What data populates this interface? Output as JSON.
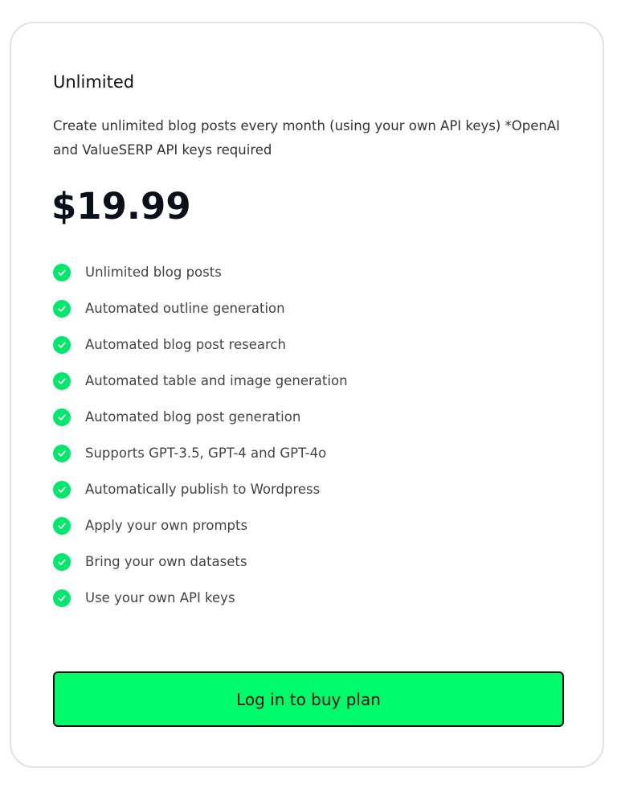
{
  "plan": {
    "name": "Unlimited",
    "description": "Create unlimited blog posts every month (using your own API keys) *OpenAI and ValueSERP API keys required",
    "price": "$19.99",
    "features": [
      "Unlimited blog posts",
      "Automated outline generation",
      "Automated blog post research",
      "Automated table and image generation",
      "Automated blog post generation",
      "Supports GPT-3.5, GPT-4 and GPT-4o",
      "Automatically publish to Wordpress",
      "Apply your own prompts",
      "Bring your own datasets",
      "Use your own API keys"
    ],
    "feature_icon": "check-circle-icon",
    "cta_label": "Log in to buy plan"
  },
  "colors": {
    "accent": "#00fb6a",
    "check": "#00e86c",
    "price": "#0b0f1a",
    "card_border": "#e2e2e2"
  }
}
